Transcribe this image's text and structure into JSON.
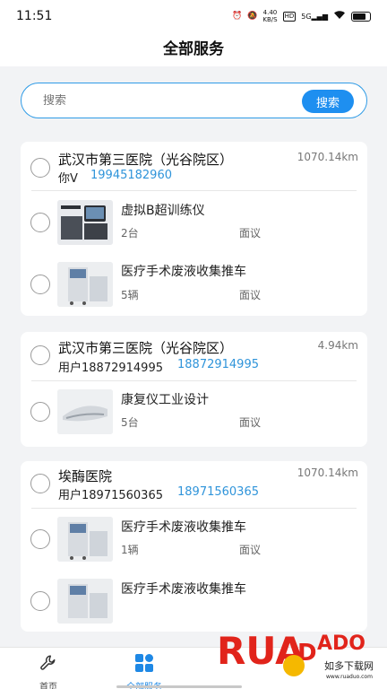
{
  "status": {
    "time": "11:51",
    "net_speed_value": "4.40",
    "net_speed_unit": "KB/S",
    "hd": "HD",
    "signal": "5G",
    "battery": "battery-icon"
  },
  "header": {
    "title": "全部服务"
  },
  "search": {
    "placeholder": "搜索",
    "button_label": "搜索"
  },
  "orders": [
    {
      "hospital": "武汉市第三医院（光谷院区）",
      "distance": "1070.14km",
      "contact": "你V",
      "phone": "19945182960",
      "items": [
        {
          "name": "虚拟B超训练仪",
          "qty": "2台",
          "price": "面议"
        },
        {
          "name": "医疗手术废液收集推车",
          "qty": "5辆",
          "price": "面议"
        }
      ]
    },
    {
      "hospital": "武汉市第三医院（光谷院区）",
      "distance": "4.94km",
      "contact": "用户18872914995",
      "phone": "18872914995",
      "items": [
        {
          "name": "康复仪工业设计",
          "qty": "5台",
          "price": "面议"
        }
      ]
    },
    {
      "hospital": "埃酶医院",
      "distance": "1070.14km",
      "contact": "用户18971560365",
      "phone": "18971560365",
      "items": [
        {
          "name": "医疗手术废液收集推车",
          "qty": "1辆",
          "price": "面议"
        },
        {
          "name": "医疗手术废液收集推车",
          "qty": "",
          "price": ""
        }
      ]
    }
  ],
  "nav": {
    "home_label": "首页",
    "services_label": "全部服务",
    "active_color": "#1e88e5"
  },
  "watermark": {
    "brand": "RUANDADO",
    "tagline": "如多下载网",
    "url": "www.ruaduo.com"
  },
  "colors": {
    "accent": "#1e8ff0",
    "phone": "#2f94da"
  }
}
